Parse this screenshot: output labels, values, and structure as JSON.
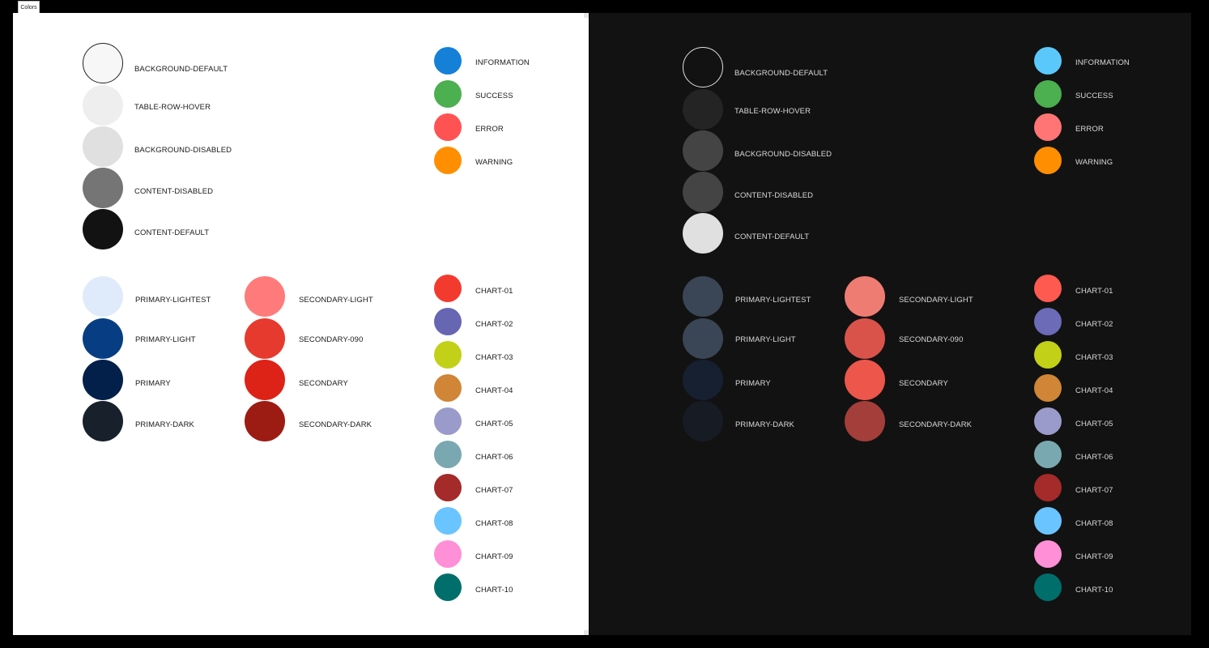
{
  "tab_label": "Colors",
  "themes": [
    {
      "name": "light",
      "neutral": [
        {
          "label": "BACKGROUND-DEFAULT",
          "color": "#f7f7f7",
          "outline": "#222222"
        },
        {
          "label": "TABLE-ROW-HOVER",
          "color": "#eeeeee"
        },
        {
          "label": "BACKGROUND-DISABLED",
          "color": "#e0e0e0"
        },
        {
          "label": "CONTENT-DISABLED",
          "color": "#757575"
        },
        {
          "label": "CONTENT-DEFAULT",
          "color": "#121212"
        }
      ],
      "status": [
        {
          "label": "INFORMATION",
          "color": "#1580d8"
        },
        {
          "label": "SUCCESS",
          "color": "#4caf50"
        },
        {
          "label": "ERROR",
          "color": "#ff5252"
        },
        {
          "label": "WARNING",
          "color": "#ff8f00"
        }
      ],
      "primary": [
        {
          "label": "PRIMARY-LIGHTEST",
          "color": "#dfebfb"
        },
        {
          "label": "PRIMARY-LIGHT",
          "color": "#073e83"
        },
        {
          "label": "PRIMARY",
          "color": "#03204a"
        },
        {
          "label": "PRIMARY-DARK",
          "color": "#18202b"
        }
      ],
      "secondary": [
        {
          "label": "SECONDARY-LIGHT",
          "color": "#ff7b7b"
        },
        {
          "label": "SECONDARY-090",
          "color": "#e63a2e"
        },
        {
          "label": "SECONDARY",
          "color": "#dd2318"
        },
        {
          "label": "SECONDARY-DARK",
          "color": "#9c1c14"
        }
      ],
      "chart": [
        {
          "label": "CHART-01",
          "color": "#f33a2f"
        },
        {
          "label": "CHART-02",
          "color": "#6666b3"
        },
        {
          "label": "CHART-03",
          "color": "#c2d018"
        },
        {
          "label": "CHART-04",
          "color": "#d08537"
        },
        {
          "label": "CHART-05",
          "color": "#9b9bcb"
        },
        {
          "label": "CHART-06",
          "color": "#7aa8b0"
        },
        {
          "label": "CHART-07",
          "color": "#a52a2a"
        },
        {
          "label": "CHART-08",
          "color": "#6ac4ff"
        },
        {
          "label": "CHART-09",
          "color": "#ff8fd6"
        },
        {
          "label": "CHART-10",
          "color": "#006e6b"
        }
      ]
    },
    {
      "name": "dark",
      "neutral": [
        {
          "label": "BACKGROUND-DEFAULT",
          "color": "#121212",
          "outline": "#e0e0e0"
        },
        {
          "label": "TABLE-ROW-HOVER",
          "color": "#242424"
        },
        {
          "label": "BACKGROUND-DISABLED",
          "color": "#444444"
        },
        {
          "label": "CONTENT-DISABLED",
          "color": "#444444"
        },
        {
          "label": "CONTENT-DEFAULT",
          "color": "#e0e0e0"
        }
      ],
      "status": [
        {
          "label": "INFORMATION",
          "color": "#5bc8fb"
        },
        {
          "label": "SUCCESS",
          "color": "#4caf50"
        },
        {
          "label": "ERROR",
          "color": "#ff7575"
        },
        {
          "label": "WARNING",
          "color": "#ff8f00"
        }
      ],
      "primary": [
        {
          "label": "PRIMARY-LIGHTEST",
          "color": "#3a4555"
        },
        {
          "label": "PRIMARY-LIGHT",
          "color": "#3a4555"
        },
        {
          "label": "PRIMARY",
          "color": "#172030"
        },
        {
          "label": "PRIMARY-DARK",
          "color": "#161b24"
        }
      ],
      "secondary": [
        {
          "label": "SECONDARY-LIGHT",
          "color": "#ef7c72"
        },
        {
          "label": "SECONDARY-090",
          "color": "#d9534a"
        },
        {
          "label": "SECONDARY",
          "color": "#ec564b"
        },
        {
          "label": "SECONDARY-DARK",
          "color": "#a33e3a"
        }
      ],
      "chart": [
        {
          "label": "CHART-01",
          "color": "#ff5a4f"
        },
        {
          "label": "CHART-02",
          "color": "#6b6bb8"
        },
        {
          "label": "CHART-03",
          "color": "#c2d018"
        },
        {
          "label": "CHART-04",
          "color": "#d08537"
        },
        {
          "label": "CHART-05",
          "color": "#9b9bcb"
        },
        {
          "label": "CHART-06",
          "color": "#7aa8b0"
        },
        {
          "label": "CHART-07",
          "color": "#a52a2a"
        },
        {
          "label": "CHART-08",
          "color": "#6ac4ff"
        },
        {
          "label": "CHART-09",
          "color": "#ff8fd6"
        },
        {
          "label": "CHART-10",
          "color": "#006e6b"
        }
      ]
    }
  ]
}
